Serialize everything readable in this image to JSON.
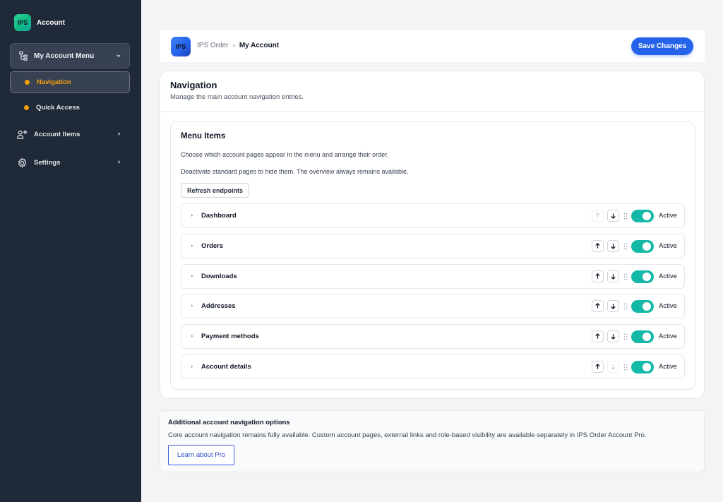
{
  "sidebar": {
    "brand_logo": "IPS",
    "brand_title": "Account",
    "group": {
      "label": "My Account Menu",
      "icon": "sitemap-icon"
    },
    "subitems": [
      {
        "label": "Navigation",
        "active": true
      },
      {
        "label": "Quick Access",
        "active": false
      }
    ],
    "items": [
      {
        "label": "Account Items",
        "icon": "user-gear-icon"
      },
      {
        "label": "Settings",
        "icon": "gear-icon"
      }
    ]
  },
  "header": {
    "logo": "IPS",
    "breadcrumb_parent": "IPS Order",
    "breadcrumb_separator": "›",
    "breadcrumb_current": "My Account",
    "save_label": "Save Changes"
  },
  "main": {
    "title": "Navigation",
    "subtitle": "Manage the main account navigation entries.",
    "menu_items": {
      "title": "Menu Items",
      "desc1": "Choose which account pages appear in the menu and arrange their order.",
      "desc2": "Deactivate standard pages to hide them. The overview always remains available.",
      "refresh_label": "Refresh endpoints",
      "rows": [
        {
          "name": "Dashboard",
          "status": "Active",
          "up_disabled": true,
          "down_disabled": false
        },
        {
          "name": "Orders",
          "status": "Active",
          "up_disabled": false,
          "down_disabled": false
        },
        {
          "name": "Downloads",
          "status": "Active",
          "up_disabled": false,
          "down_disabled": false
        },
        {
          "name": "Addresses",
          "status": "Active",
          "up_disabled": false,
          "down_disabled": false
        },
        {
          "name": "Payment methods",
          "status": "Active",
          "up_disabled": false,
          "down_disabled": false
        },
        {
          "name": "Account details",
          "status": "Active",
          "up_disabled": false,
          "down_disabled": true
        }
      ]
    }
  },
  "pro": {
    "title": "Additional account navigation options",
    "text": "Core account navigation remains fully available. Custom account pages, external links and role-based visibility are available separately in IPS Order Account Pro.",
    "button_label": "Learn about Pro"
  },
  "colors": {
    "sidebar_bg": "#1f2937",
    "accent": "#f59e0b",
    "primary": "#2563eb",
    "toggle_on": "#14b8a6"
  }
}
